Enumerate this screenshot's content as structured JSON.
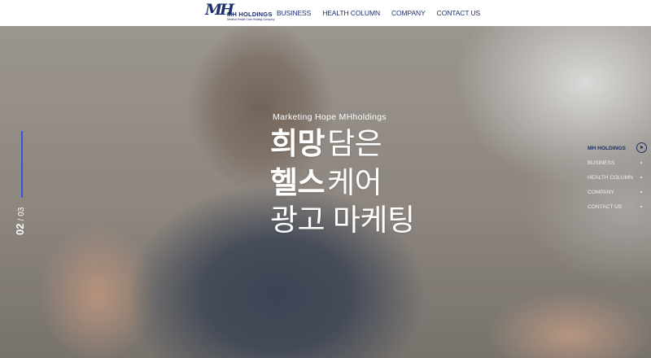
{
  "header": {
    "logo": {
      "mark": "MH",
      "name": "MH HOLDINGS",
      "tagline": "Medical Health Care Holding Company"
    },
    "nav": [
      {
        "label": "BUSINESS"
      },
      {
        "label": "HEALTH COLUMN"
      },
      {
        "label": "COMPANY"
      },
      {
        "label": "CONTACT US"
      }
    ]
  },
  "hero": {
    "eyebrow": "Marketing Hope MHholdings",
    "lines": [
      {
        "bold": "희망",
        "regular": "담은"
      },
      {
        "bold": "헬스",
        "regular": "케어"
      },
      {
        "bold": "",
        "regular": "광고 마케팅"
      }
    ]
  },
  "slide_counter": {
    "current": "02",
    "separator": "/",
    "total": "03",
    "progress": 0.67
  },
  "side_menu": [
    {
      "label": "MH HOLDINGS",
      "active": true
    },
    {
      "label": "BUSINESS",
      "active": false
    },
    {
      "label": "HEALTH COLUMN",
      "active": false
    },
    {
      "label": "COMPANY",
      "active": false
    },
    {
      "label": "CONTACT US",
      "active": false
    }
  ],
  "colors": {
    "brand": "#1d2f6b",
    "accent": "#3a55d8",
    "header_bg": "#ffffff",
    "hero_text": "#ffffff"
  }
}
